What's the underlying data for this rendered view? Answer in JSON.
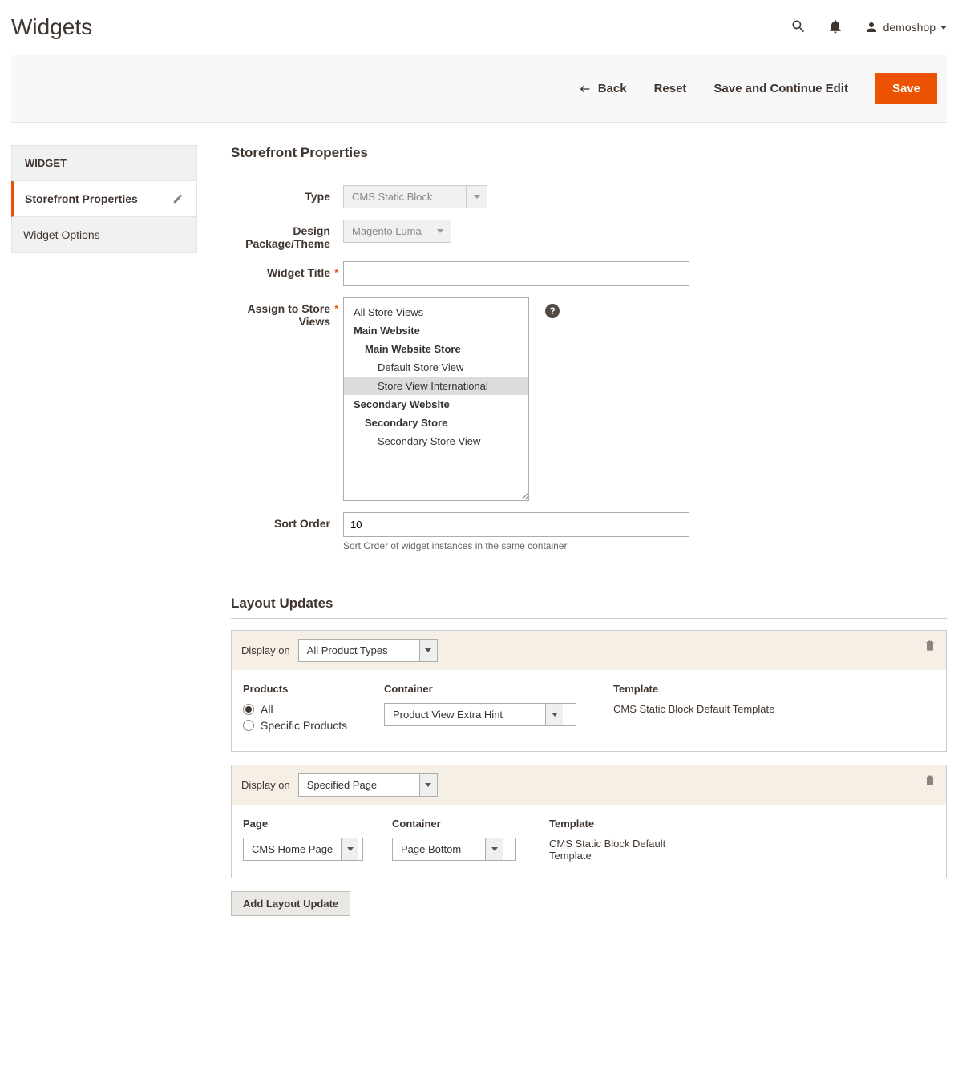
{
  "header": {
    "title": "Widgets",
    "username": "demoshop"
  },
  "actions": {
    "back": "Back",
    "reset": "Reset",
    "save_continue": "Save and Continue Edit",
    "save": "Save"
  },
  "sidebar": {
    "heading": "WIDGET",
    "items": [
      {
        "label": "Storefront Properties",
        "active": true
      },
      {
        "label": "Widget Options",
        "active": false
      }
    ]
  },
  "storefront": {
    "section_title": "Storefront Properties",
    "type_label": "Type",
    "type_value": "CMS Static Block",
    "theme_label": "Design Package/Theme",
    "theme_value": "Magento Luma",
    "title_label": "Widget Title",
    "title_value": "",
    "stores_label": "Assign to Store Views",
    "store_views": [
      {
        "text": "All Store Views",
        "level": 0,
        "bold": false,
        "selected": false
      },
      {
        "text": "Main Website",
        "level": 0,
        "bold": true,
        "selected": false
      },
      {
        "text": "Main Website Store",
        "level": 1,
        "bold": true,
        "selected": false
      },
      {
        "text": "Default Store View",
        "level": 2,
        "bold": false,
        "selected": false
      },
      {
        "text": "Store View International",
        "level": 2,
        "bold": false,
        "selected": true
      },
      {
        "text": "Secondary Website",
        "level": 0,
        "bold": true,
        "selected": false
      },
      {
        "text": "Secondary Store",
        "level": 1,
        "bold": true,
        "selected": false
      },
      {
        "text": "Secondary Store View",
        "level": 2,
        "bold": false,
        "selected": false
      }
    ],
    "sort_label": "Sort Order",
    "sort_value": "10",
    "sort_hint": "Sort Order of widget instances in the same container"
  },
  "layout": {
    "section_title": "Layout Updates",
    "display_on_label": "Display on",
    "blocks": [
      {
        "display_on": "All Product Types",
        "col1_label": "Products",
        "products_options": [
          {
            "label": "All",
            "checked": true
          },
          {
            "label": "Specific Products",
            "checked": false
          }
        ],
        "col2_label": "Container",
        "container_value": "Product View Extra Hint",
        "col3_label": "Template",
        "template_text": "CMS Static Block Default Template"
      },
      {
        "display_on": "Specified Page",
        "col1_label": "Page",
        "page_value": "CMS Home Page",
        "col2_label": "Container",
        "container_value": "Page Bottom",
        "col3_label": "Template",
        "template_text": "CMS Static Block Default Template"
      }
    ],
    "add_button": "Add Layout Update"
  }
}
